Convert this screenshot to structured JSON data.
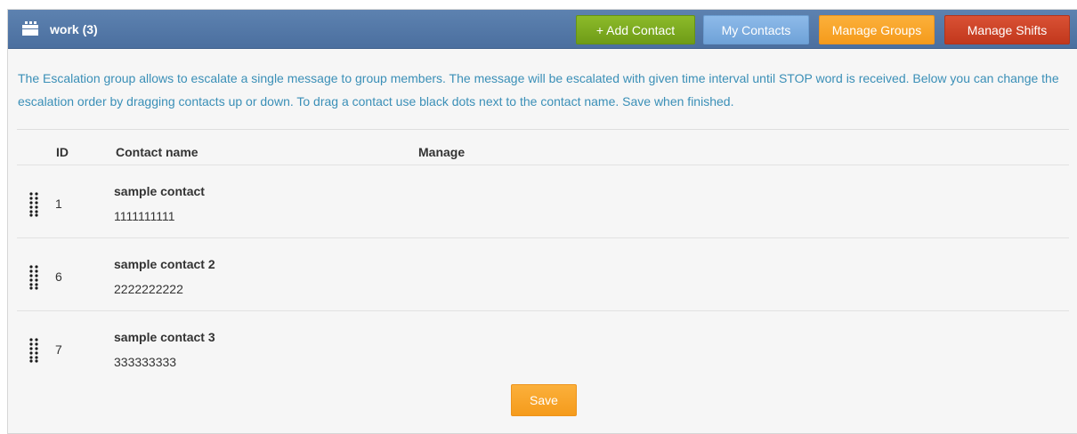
{
  "header": {
    "icon": "calendar-icon",
    "title": "work (3)",
    "buttons": {
      "add_contact": "+ Add Contact",
      "my_contacts": "My Contacts",
      "manage_groups": "Manage Groups",
      "manage_shifts": "Manage Shifts"
    }
  },
  "info": "The Escalation group allows to escalate a single message to group members. The message will be escalated with given time interval until STOP word is received. Below you can change the escalation order by dragging contacts up or down. To drag a contact use black dots next to the contact name. Save when finished.",
  "table": {
    "columns": [
      "ID",
      "Contact name",
      "Manage"
    ],
    "rows": [
      {
        "id": "1",
        "name": "sample contact",
        "phone": "1111111111",
        "icon": "drag-handle-icon"
      },
      {
        "id": "6",
        "name": "sample contact 2",
        "phone": "2222222222",
        "icon": "drag-handle-icon"
      },
      {
        "id": "7",
        "name": "sample contact 3",
        "phone": "333333333",
        "icon": "drag-handle-icon"
      }
    ]
  },
  "save_label": "Save",
  "colors": {
    "header": "#4f73a3",
    "info_text": "#3a8fb7",
    "add_contact": "#7aab1f",
    "my_contacts": "#7aaee2",
    "manage_groups": "#f7a42a",
    "manage_shifts": "#cc4427",
    "save": "#f7a42a"
  }
}
